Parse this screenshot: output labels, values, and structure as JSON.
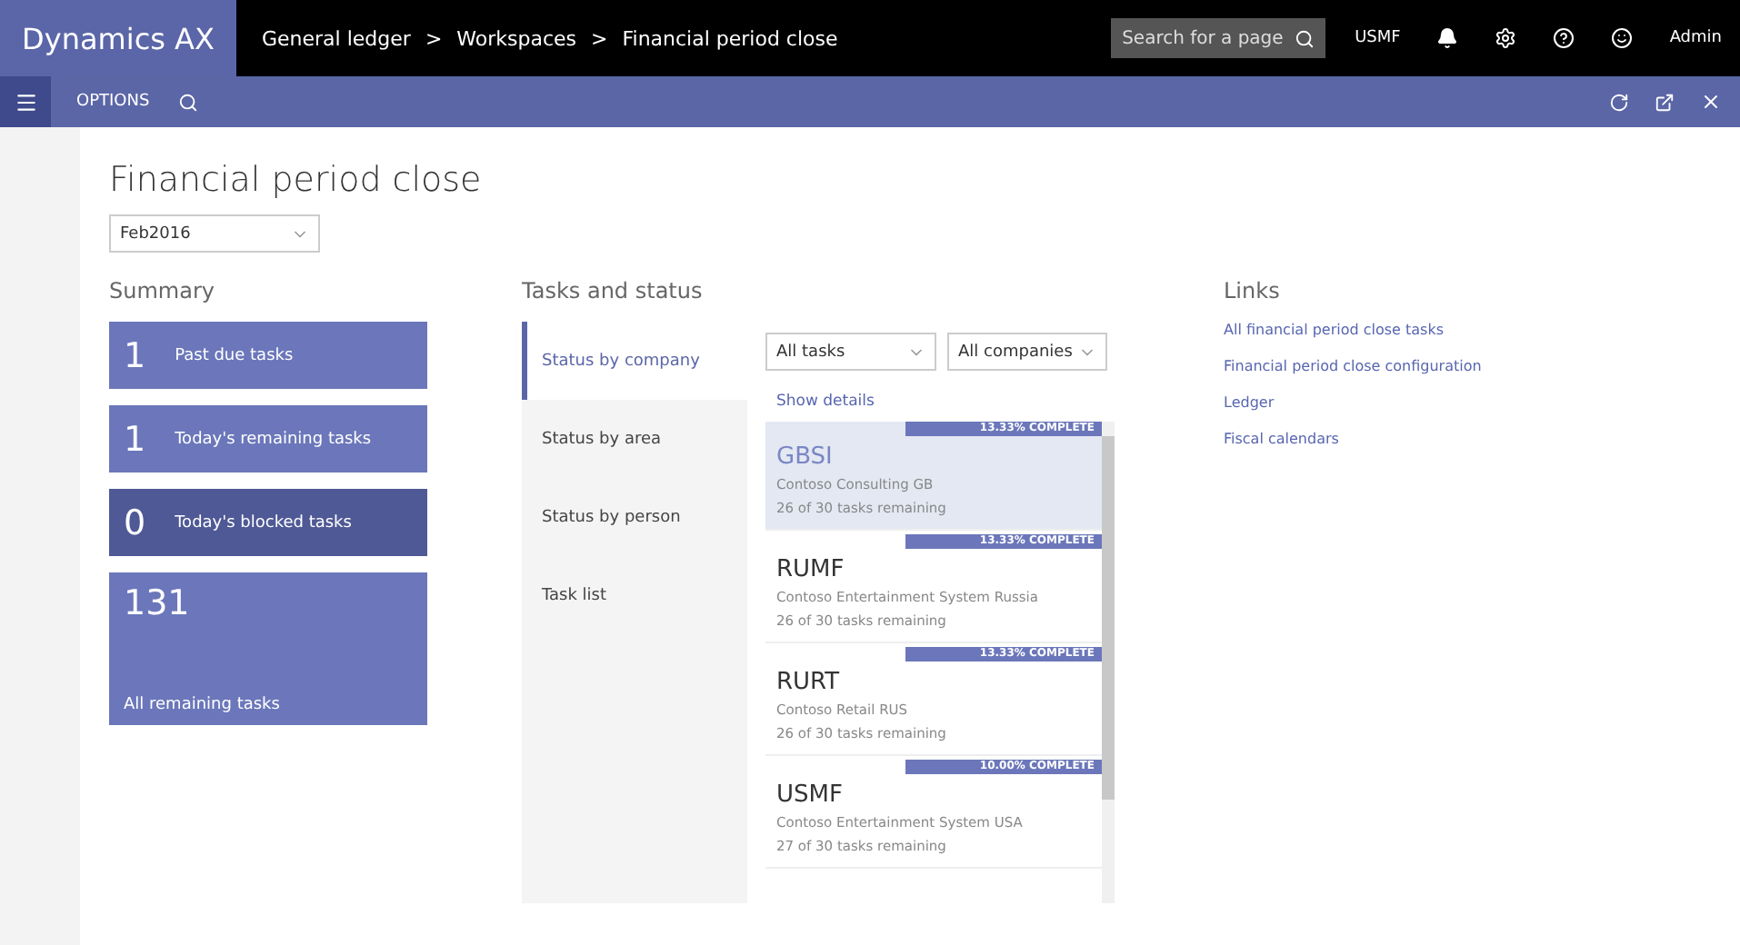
{
  "header": {
    "app_name": "Dynamics AX",
    "breadcrumb": [
      "General ledger",
      "Workspaces",
      "Financial period close"
    ],
    "separators": [
      ">",
      ">"
    ],
    "search": {
      "placeholder": "Search for a page"
    },
    "company": "USMF",
    "user": "Admin"
  },
  "action_bar": {
    "label": "OPTIONS"
  },
  "page": {
    "title": "Financial period close",
    "period": "Feb2016"
  },
  "summary": {
    "title": "Summary",
    "tiles": [
      {
        "count": "1",
        "label": "Past due tasks",
        "kind": "normal"
      },
      {
        "count": "1",
        "label": "Today's remaining tasks",
        "kind": "normal"
      },
      {
        "count": "0",
        "label": "Today's blocked tasks",
        "kind": "alert"
      },
      {
        "count": "131",
        "label": "All remaining tasks",
        "kind": "large"
      }
    ]
  },
  "tasks": {
    "title": "Tasks and status",
    "nav": [
      {
        "label": "Status by company",
        "selected": true
      },
      {
        "label": "Status by area",
        "selected": false
      },
      {
        "label": "Status by person",
        "selected": false
      },
      {
        "label": "Task list",
        "selected": false
      }
    ],
    "task_filter": "All tasks",
    "company_filter": "All companies",
    "show_details": "Show details",
    "companies": [
      {
        "code": "GBSI",
        "name": "Contoso Consulting GB",
        "remaining": "26 of 30 tasks remaining",
        "badge": "13.33% COMPLETE",
        "selected": true
      },
      {
        "code": "RUMF",
        "name": "Contoso Entertainment System Russia",
        "remaining": "26 of 30 tasks remaining",
        "badge": "13.33% COMPLETE",
        "selected": false
      },
      {
        "code": "RURT",
        "name": "Contoso Retail RUS",
        "remaining": "26 of 30 tasks remaining",
        "badge": "13.33% COMPLETE",
        "selected": false
      },
      {
        "code": "USMF",
        "name": "Contoso Entertainment System USA",
        "remaining": "27 of 30 tasks remaining",
        "badge": "10.00% COMPLETE",
        "selected": false
      }
    ]
  },
  "links": {
    "title": "Links",
    "items": [
      "All financial period close tasks",
      "Financial period close configuration",
      "Ledger",
      "Fiscal calendars"
    ]
  }
}
